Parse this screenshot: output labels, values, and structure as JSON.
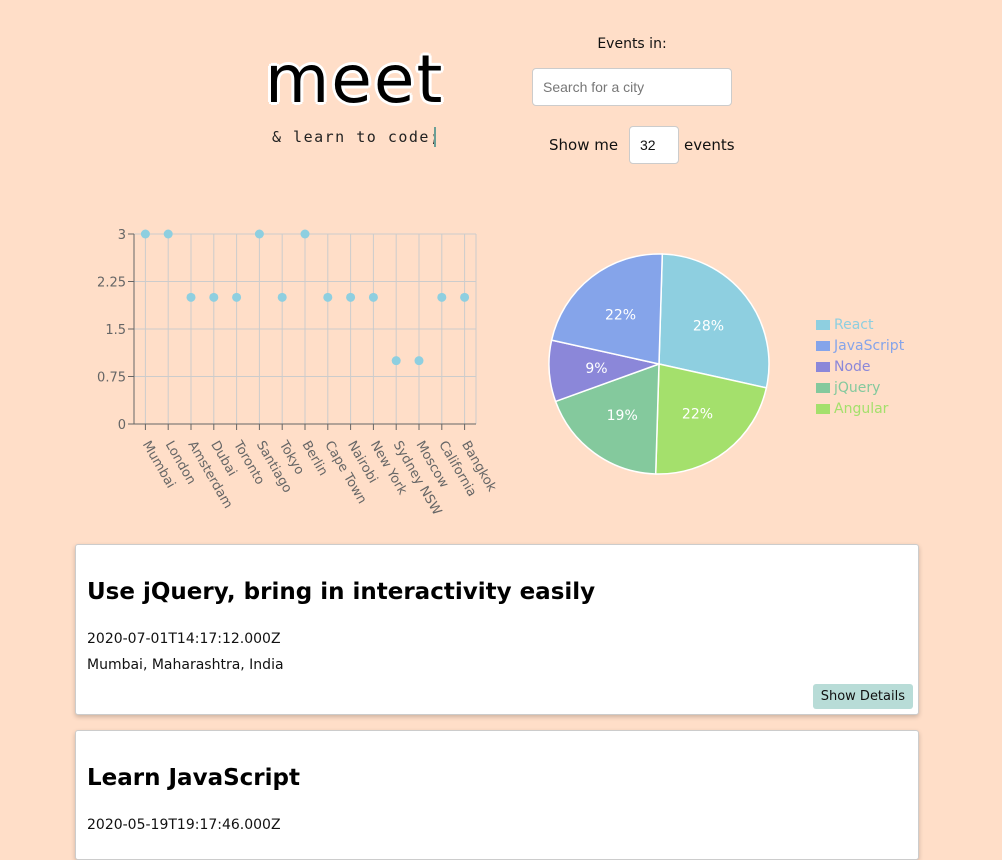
{
  "header": {
    "logo": "meet",
    "tagline": "& learn to code;"
  },
  "search": {
    "label": "Events in:",
    "placeholder": "Search for a city",
    "value": ""
  },
  "number_of_events": {
    "prefix": "Show me",
    "value": "32",
    "suffix": "events"
  },
  "chart_data": [
    {
      "type": "scatter",
      "categories": [
        "Mumbai",
        "London",
        "Amsterdam",
        "Dubai",
        "Toronto",
        "Santiago",
        "Tokyo",
        "Berlin",
        "Cape Town",
        "Nairobi",
        "New York",
        "Sydney NSW",
        "Moscow",
        "California",
        "Bangkok"
      ],
      "values": [
        3,
        3,
        2,
        2,
        2,
        3,
        2,
        3,
        2,
        2,
        2,
        1,
        1,
        2,
        2
      ],
      "yticks": [
        "0",
        "0.75",
        "1.5",
        "2.25",
        "3"
      ],
      "ylim": [
        0,
        3
      ],
      "grid": true,
      "color": "#8ecfe0"
    },
    {
      "type": "pie",
      "slices": [
        {
          "name": "React",
          "value": 28,
          "label": "28%",
          "color": "#8ecfe0"
        },
        {
          "name": "Angular",
          "value": 22,
          "label": "22%",
          "color": "#a4e06c"
        },
        {
          "name": "jQuery",
          "value": 19,
          "label": "19%",
          "color": "#84c99d"
        },
        {
          "name": "Node",
          "value": 9,
          "label": "9%",
          "color": "#8b87d9"
        },
        {
          "name": "JavaScript",
          "value": 22,
          "label": "22%",
          "color": "#85a4ea"
        }
      ],
      "legend": [
        {
          "name": "React",
          "color": "#8ecfe0"
        },
        {
          "name": "JavaScript",
          "color": "#85a4ea"
        },
        {
          "name": "Node",
          "color": "#8b87d9"
        },
        {
          "name": "jQuery",
          "color": "#84c99d"
        },
        {
          "name": "Angular",
          "color": "#a4e06c"
        }
      ],
      "legend_position": "right"
    }
  ],
  "events": [
    {
      "title": "Use jQuery, bring in interactivity easily",
      "date": "2020-07-01T14:17:12.000Z",
      "location": "Mumbai, Maharashtra, India",
      "button": "Show Details"
    },
    {
      "title": "Learn JavaScript",
      "date": "2020-05-19T19:17:46.000Z"
    }
  ],
  "colors": {
    "background": "#ffdec8",
    "button": "#b8dcd7"
  }
}
